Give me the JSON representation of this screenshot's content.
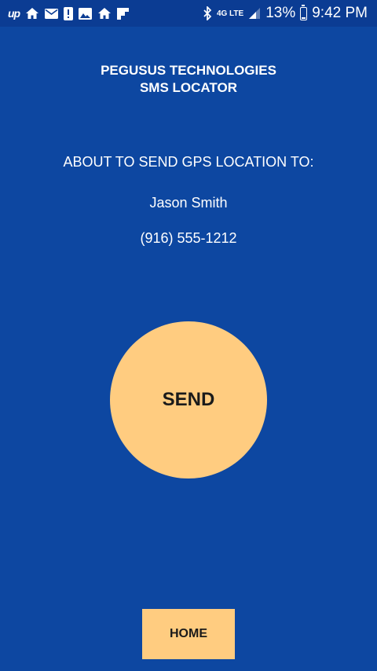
{
  "status_bar": {
    "left_icons": [
      "up-app-icon",
      "home-icon",
      "mail-icon",
      "alert-icon",
      "image-icon",
      "home-icon",
      "flipboard-icon"
    ],
    "up_label": "up",
    "network": "4G LTE",
    "battery_percent": "13%",
    "battery_level": 0.13,
    "time": "9:42 PM"
  },
  "header": {
    "line1": "PEGUSUS TECHNOLOGIES",
    "line2": "SMS LOCATOR"
  },
  "content": {
    "about_label": "ABOUT TO SEND GPS LOCATION TO:",
    "contact_name": "Jason Smith",
    "contact_phone": "(916) 555-1212"
  },
  "actions": {
    "send_label": "SEND",
    "home_label": "HOME"
  },
  "colors": {
    "background": "#0d47a1",
    "button": "#ffcc80",
    "text": "#ffffff"
  }
}
